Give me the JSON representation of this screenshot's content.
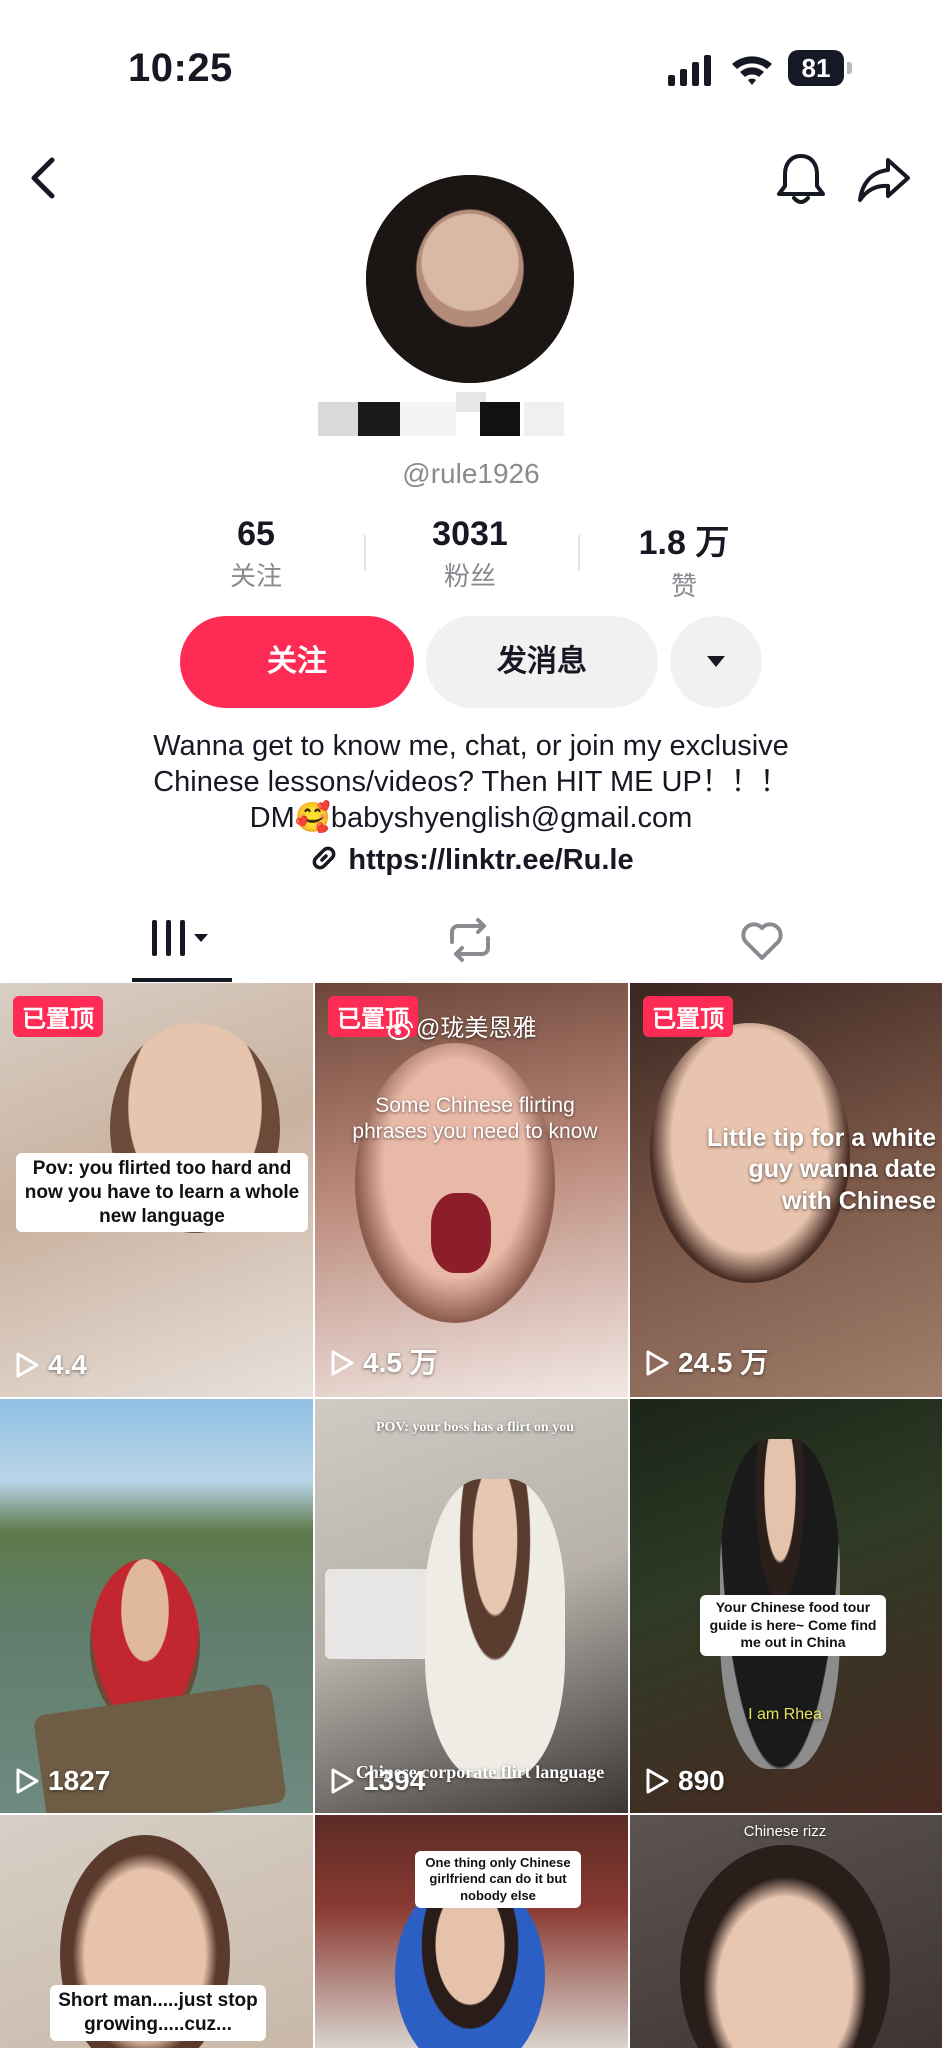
{
  "status_bar": {
    "time": "10:25",
    "battery": "81"
  },
  "profile": {
    "handle": "@rule1926",
    "stats": [
      {
        "value": "65",
        "label": "关注"
      },
      {
        "value": "3031",
        "label": "粉丝"
      },
      {
        "value": "1.8 万",
        "label": "赞"
      }
    ],
    "buttons": {
      "follow": "关注",
      "message": "发消息"
    },
    "bio_lines": [
      "Wanna get to know me, chat, or join my exclusive",
      "Chinese lessons/videos? Then HIT ME UP！！！",
      "DM🥰babyshyenglish@gmail.com"
    ],
    "link": "https://linktr.ee/Ru.le"
  },
  "tabs": [
    "videos-tab",
    "reposts-tab",
    "liked-tab"
  ],
  "watermark": "@珑美恩雅",
  "videos": [
    {
      "pinned": "已置顶",
      "views": "4.4",
      "caption": "Pov: you flirted too hard and now you have to learn a whole new language"
    },
    {
      "pinned": "已置顶",
      "views": "4.5 万",
      "caption": "Some Chinese flirting phrases you need to know"
    },
    {
      "pinned": "已置顶",
      "views": "24.5 万",
      "caption": "Little tip for a white guy wanna date with Chinese"
    },
    {
      "views": "1827",
      "caption": ""
    },
    {
      "views": "1394",
      "caption": "POV: your boss has a flirt on you",
      "caption2": "Chinese corporate flirt language"
    },
    {
      "views": "890",
      "caption": "Your Chinese food tour guide is here~ Come find me out in China",
      "caption2": "I am Rhea"
    },
    {
      "views": "",
      "caption": "Short man.....just stop growing.....cuz..."
    },
    {
      "views": "",
      "caption": "One thing only Chinese girlfriend can do it but nobody else"
    },
    {
      "views": "",
      "caption": "Chinese rizz"
    }
  ]
}
